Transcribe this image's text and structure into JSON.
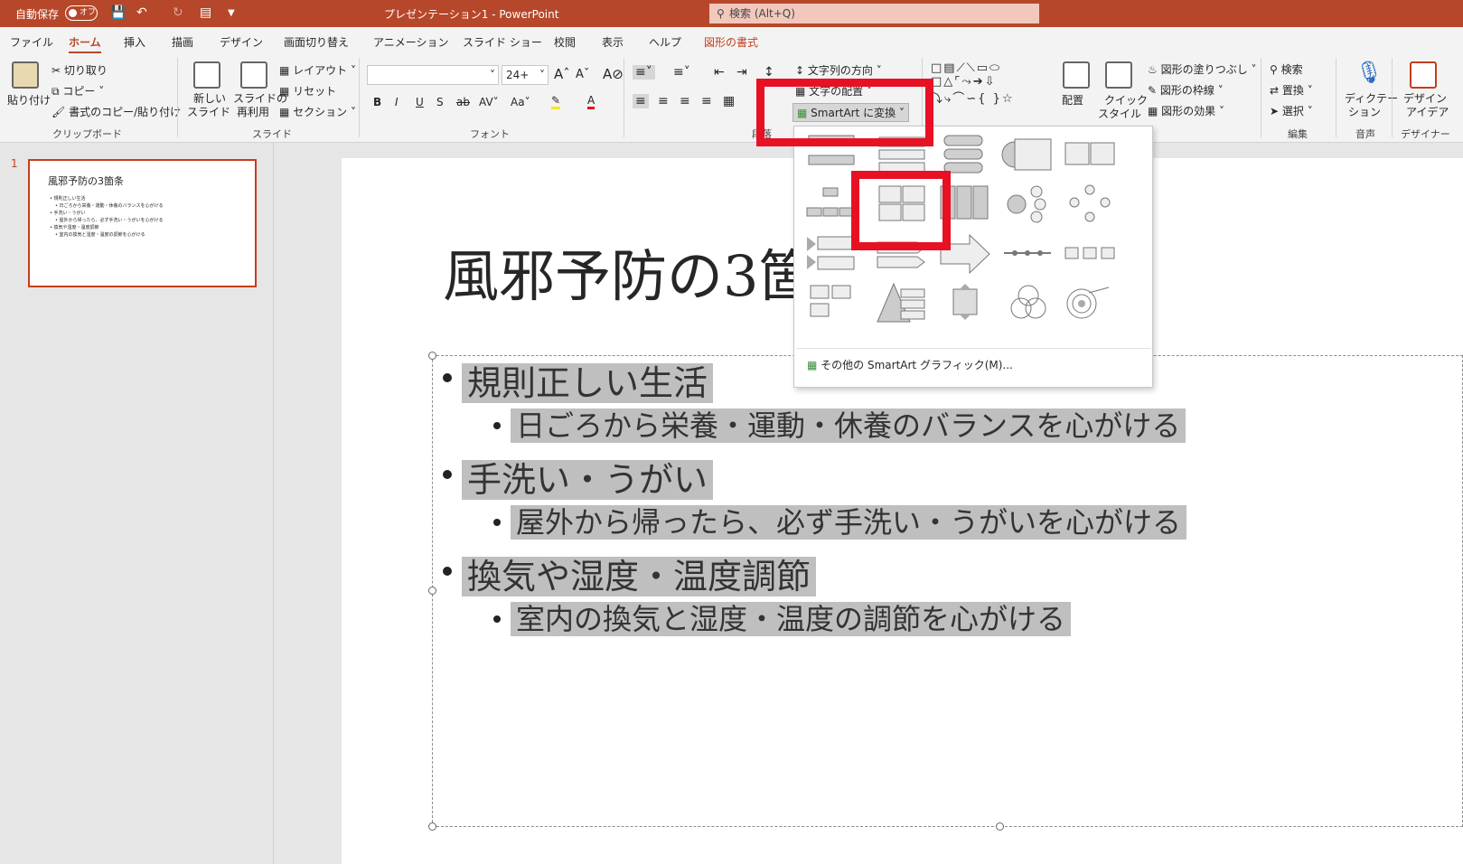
{
  "titlebar": {
    "autosave_label": "自動保存",
    "autosave_state": "オフ",
    "title": "プレゼンテーション1 - PowerPoint",
    "search_placeholder": "検索 (Alt+Q)"
  },
  "tabs": [
    "ファイル",
    "ホーム",
    "挿入",
    "描画",
    "デザイン",
    "画面切り替え",
    "アニメーション",
    "スライド ショー",
    "校閲",
    "表示",
    "ヘルプ",
    "図形の書式"
  ],
  "ribbon": {
    "clipboard": {
      "paste": "貼り付け",
      "cut": "切り取り",
      "copy": "コピー",
      "format_painter": "書式のコピー/貼り付け",
      "group": "クリップボード"
    },
    "slides": {
      "new_slide_1": "新しい",
      "new_slide_2": "スライド",
      "reuse_1": "スライドの",
      "reuse_2": "再利用",
      "layout": "レイアウト",
      "reset": "リセット",
      "section": "セクション",
      "group": "スライド"
    },
    "font": {
      "font_name": "",
      "font_size": "24+",
      "group": "フォント"
    },
    "paragraph": {
      "text_direction": "文字列の方向",
      "align_text": "文字の配置",
      "smartart": "SmartArt に変換",
      "group": "段落"
    },
    "drawing": {
      "arrange": "配置",
      "quick_styles_1": "クイック",
      "quick_styles_2": "スタイル",
      "shape_fill": "図形の塗りつぶし",
      "shape_outline": "図形の枠線",
      "shape_effects": "図形の効果"
    },
    "editing": {
      "find": "検索",
      "replace": "置換",
      "select": "選択",
      "group": "編集"
    },
    "voice": {
      "dictate_1": "ディクテー",
      "dictate_2": "ション",
      "group": "音声"
    },
    "designer": {
      "ideas_1": "デザイン",
      "ideas_2": "アイデア",
      "group": "デザイナー"
    }
  },
  "gallery": {
    "more_smartart": "その他の SmartArt グラフィック(M)..."
  },
  "thumbnail": {
    "number": "1",
    "title": "風邪予防の3箇条",
    "lines": [
      "• 規則正しい生活",
      "• 日ごろから栄養・運動・休養のバランスを心がける",
      "• 手洗い・うがい",
      "• 屋外から帰ったら、必ず手洗い・うがいを心がける",
      "• 換気や湿度・温度調節",
      "• 室内の換気と湿度・温度の調節を心がける"
    ]
  },
  "slide": {
    "title": "風邪予防の3箇",
    "bullets": [
      {
        "text": "規則正しい生活",
        "sub": "日ごろから栄養・運動・休養のバランスを心がける"
      },
      {
        "text": "手洗い・うがい",
        "sub": "屋外から帰ったら、必ず手洗い・うがいを心がける"
      },
      {
        "text": "換気や湿度・温度調節",
        "sub": "室内の換気と湿度・温度の調節を心がける"
      }
    ]
  },
  "colors": {
    "accent": "#b7472a",
    "highlight_box": "#e81123",
    "selection": "#bfbfbf"
  }
}
